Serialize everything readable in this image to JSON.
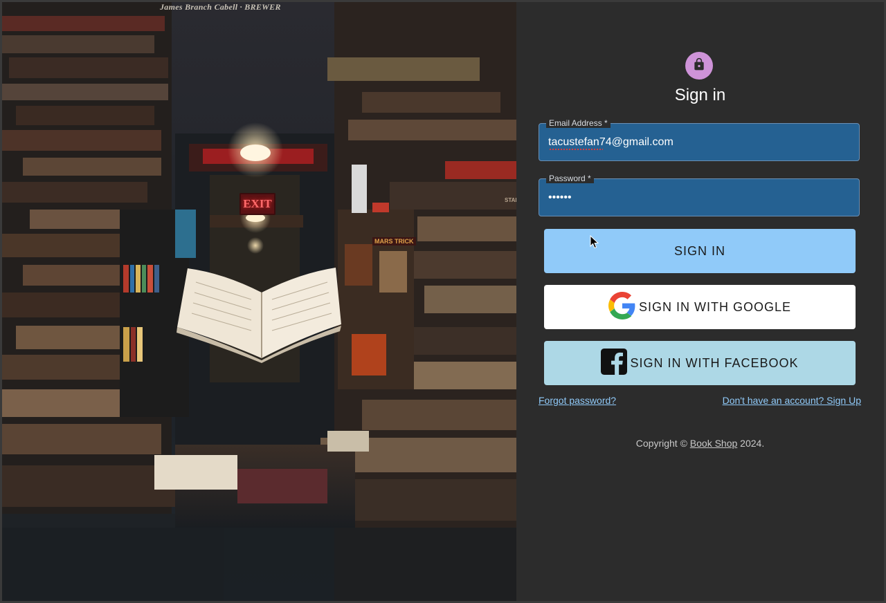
{
  "hero": {
    "caption": "James Branch Cabell · BREWER",
    "exit_sign": "EXIT",
    "shelf_tag": "MARS TRICK",
    "shelf_label": "STAR"
  },
  "form": {
    "title": "Sign in",
    "email": {
      "label": "Email Address *",
      "value": "tacustefan74@gmail.com"
    },
    "password": {
      "label": "Password *",
      "value": "••••••"
    },
    "signin_button": "SIGN IN",
    "google_button": "SIGN IN WITH GOOGLE",
    "facebook_button": "SIGN IN WITH FACEBOOK",
    "forgot_password": "Forgot password?",
    "signup_link": "Don't have an account? Sign Up"
  },
  "footer": {
    "prefix": "Copyright © ",
    "brand": "Book Shop",
    "suffix": " 2024."
  },
  "colors": {
    "accent": "#90caf9",
    "avatar": "#ce93d8",
    "field_bg": "#256192",
    "facebook_bg": "#add8e6",
    "panel_bg": "#2c2c2c"
  }
}
